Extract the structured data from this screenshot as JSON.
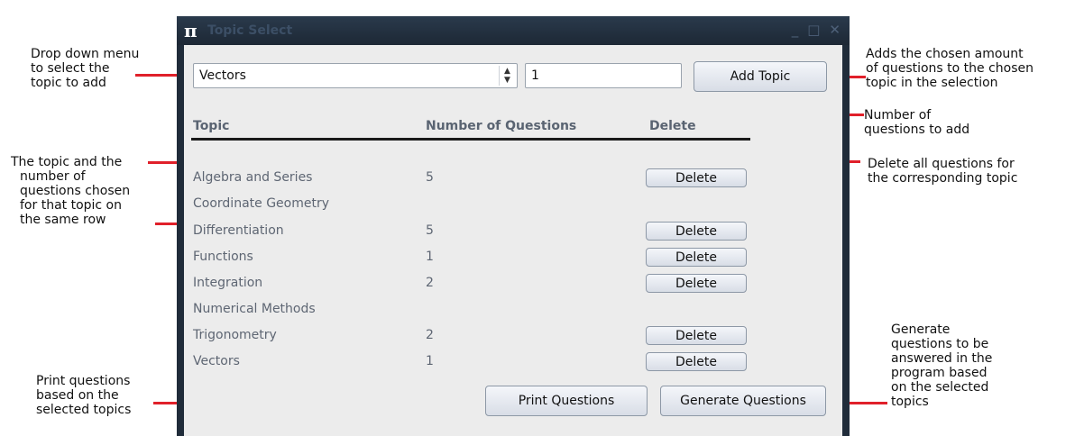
{
  "window": {
    "title": "Topic Select",
    "icon": "pi-icon",
    "controls": {
      "minimize": "_",
      "maximize": "□",
      "close": "✕"
    }
  },
  "form": {
    "topic_select_value": "Vectors",
    "quantity_value": "1",
    "add_button": "Add Topic"
  },
  "table": {
    "headers": [
      "Topic",
      "Number of Questions",
      "Delete"
    ],
    "rows": [
      {
        "topic": "Algebra and Series",
        "count": "5",
        "delete": "Delete"
      },
      {
        "topic": "Coordinate Geometry",
        "count": "",
        "delete": ""
      },
      {
        "topic": "Differentiation",
        "count": "5",
        "delete": "Delete"
      },
      {
        "topic": "Functions",
        "count": "1",
        "delete": "Delete"
      },
      {
        "topic": "Integration",
        "count": "2",
        "delete": "Delete"
      },
      {
        "topic": "Numerical Methods",
        "count": "",
        "delete": ""
      },
      {
        "topic": "Trigonometry",
        "count": "2",
        "delete": "Delete"
      },
      {
        "topic": "Vectors",
        "count": "1",
        "delete": "Delete"
      }
    ]
  },
  "footer": {
    "print_button": "Print Questions",
    "generate_button": "Generate Questions"
  },
  "annotations": {
    "dropdown": [
      "Drop down menu",
      "to select the",
      "topic to add"
    ],
    "add_topic": [
      "Adds the chosen amount",
      "of questions to the chosen",
      "topic in the selection"
    ],
    "quantity": [
      "Number of",
      "questions to add"
    ],
    "delete": [
      "Delete all questions for",
      "the corresponding topic"
    ],
    "row": [
      "The topic and the",
      "number of",
      "questions chosen",
      "for that topic on",
      "the same row"
    ],
    "print": [
      "Print questions",
      "based on the",
      "selected topics"
    ],
    "generate": [
      "Generate",
      "questions to be",
      "answered in the",
      "program based",
      "on the selected",
      "topics"
    ]
  },
  "colors": {
    "annotation_line": "#e0202a",
    "window_frame": "#202c3a",
    "client_bg": "#ececec"
  }
}
